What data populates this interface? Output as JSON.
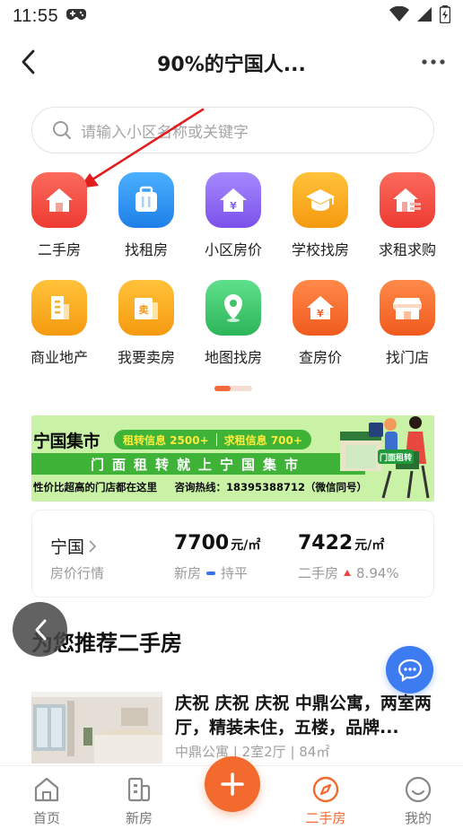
{
  "status_bar": {
    "time": "11:55"
  },
  "nav": {
    "title": "90%的宁国人..."
  },
  "search": {
    "placeholder": "请输入小区名称或关键字"
  },
  "grid": [
    {
      "label": "二手房",
      "icon": "house-icon",
      "color": "#f0483e"
    },
    {
      "label": "找租房",
      "icon": "suitcase-icon",
      "color": "#2f8ff0"
    },
    {
      "label": "小区房价",
      "icon": "price-house-icon",
      "color": "#8a63f0"
    },
    {
      "label": "学校找房",
      "icon": "graduation-cap-icon",
      "color": "#f7a21b"
    },
    {
      "label": "求租求购",
      "icon": "house-list-icon",
      "color": "#f0483e"
    },
    {
      "label": "商业地产",
      "icon": "building-icon",
      "color": "#f7a21b"
    },
    {
      "label": "我要卖房",
      "icon": "sell-icon",
      "color": "#f7a21b"
    },
    {
      "label": "地图找房",
      "icon": "map-pin-icon",
      "color": "#3fc36a"
    },
    {
      "label": "查房价",
      "icon": "yen-house-icon",
      "color": "#f26a2e"
    },
    {
      "label": "找门店",
      "icon": "storefront-icon",
      "color": "#f26a2e"
    }
  ],
  "banner": {
    "brand": "宁国集市",
    "rent_info": "租转信息 2500+",
    "seek_info": "求租信息 700+",
    "slogan": "门面租转就上宁国集市",
    "footer_left": "性价比超高的门店都在这里",
    "footer_right": "咨询热线：18395388712（微信同号）",
    "sign": "门面租转"
  },
  "price_card": {
    "city": "宁国",
    "city_sub": "房价行情",
    "new_price": "7700",
    "unit": "元/㎡",
    "new_label": "新房",
    "new_trend": "持平",
    "second_price": "7422",
    "second_label": "二手房",
    "second_trend": "8.94%"
  },
  "section": {
    "title": "为您推荐二手房"
  },
  "listing": {
    "title": "庆祝 庆祝 庆祝 中鼎公寓，两室两厅，精装未住，五楼，品牌...",
    "meta": "中鼎公寓 | 2室2厅 | 84㎡"
  },
  "tabbar": {
    "home": "首页",
    "new_house": "新房",
    "second_hand": "二手房",
    "mine": "我的"
  },
  "colors": {
    "accent": "#f26a2e",
    "chat": "#3d7bf0",
    "banner_green": "#3fb338"
  }
}
